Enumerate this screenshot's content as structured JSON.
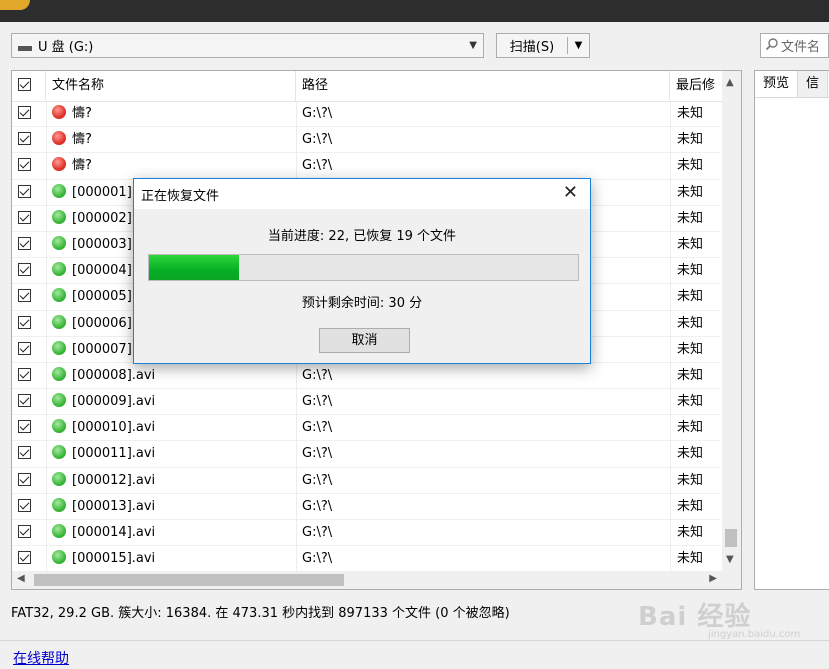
{
  "toolbar": {
    "drive_label": "U 盘 (G:)",
    "scan_label": "扫描(S)",
    "search_placeholder": "文件名"
  },
  "columns": [
    "文件名称",
    "路径",
    "最后修"
  ],
  "rows": [
    {
      "status": "red",
      "name": "懤?",
      "path": "G:\\?\\",
      "date": "未知"
    },
    {
      "status": "red",
      "name": "懤?",
      "path": "G:\\?\\",
      "date": "未知"
    },
    {
      "status": "red",
      "name": "懤?",
      "path": "G:\\?\\",
      "date": "未知"
    },
    {
      "status": "green",
      "name": "[000001]",
      "path": "",
      "date": "未知"
    },
    {
      "status": "green",
      "name": "[000002]",
      "path": "",
      "date": "未知"
    },
    {
      "status": "green",
      "name": "[000003]",
      "path": "",
      "date": "未知"
    },
    {
      "status": "green",
      "name": "[000004]",
      "path": "",
      "date": "未知"
    },
    {
      "status": "green",
      "name": "[000005]",
      "path": "",
      "date": "未知"
    },
    {
      "status": "green",
      "name": "[000006]",
      "path": "",
      "date": "未知"
    },
    {
      "status": "green",
      "name": "[000007]",
      "path": "",
      "date": "未知"
    },
    {
      "status": "green",
      "name": "[000008].avi",
      "path": "G:\\?\\",
      "date": "未知"
    },
    {
      "status": "green",
      "name": "[000009].avi",
      "path": "G:\\?\\",
      "date": "未知"
    },
    {
      "status": "green",
      "name": "[000010].avi",
      "path": "G:\\?\\",
      "date": "未知"
    },
    {
      "status": "green",
      "name": "[000011].avi",
      "path": "G:\\?\\",
      "date": "未知"
    },
    {
      "status": "green",
      "name": "[000012].avi",
      "path": "G:\\?\\",
      "date": "未知"
    },
    {
      "status": "green",
      "name": "[000013].avi",
      "path": "G:\\?\\",
      "date": "未知"
    },
    {
      "status": "green",
      "name": "[000014].avi",
      "path": "G:\\?\\",
      "date": "未知"
    },
    {
      "status": "green",
      "name": "[000015].avi",
      "path": "G:\\?\\",
      "date": "未知"
    }
  ],
  "right_panel": {
    "tabs": [
      "预览",
      "信"
    ]
  },
  "status": {
    "text": "FAT32, 29.2 GB. 簇大小: 16384. 在 473.31 秒内找到 897133 个文件 (0 个被忽略)"
  },
  "help_link": "在线帮助",
  "watermark": {
    "brand": "Bai 经验",
    "url": "jingyan.baidu.com"
  },
  "dialog": {
    "title": "正在恢复文件",
    "progress_text": "当前进度: 22, 已恢复 19 个文件",
    "progress_percent": 21,
    "remaining_text": "预计剩余时间: 30 分",
    "cancel_label": "取消",
    "close_glyph": "✕"
  },
  "colors": {
    "progress_fill": "#06b025",
    "dialog_border": "#1c80d8",
    "link": "#0000cc"
  }
}
